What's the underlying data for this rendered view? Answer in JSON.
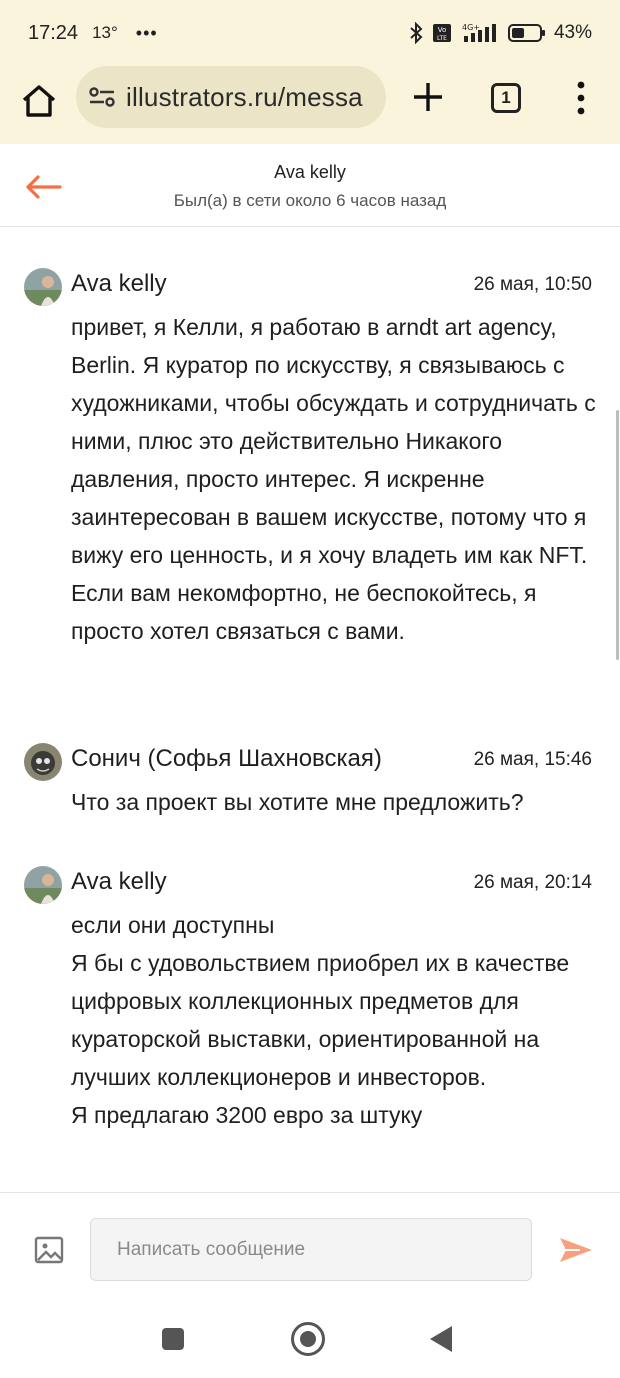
{
  "status_bar": {
    "time": "17:24",
    "temperature": "13°",
    "dots": "•••",
    "battery": "43%"
  },
  "browser": {
    "url": "illustrators.ru/messa",
    "tab_count": "1"
  },
  "chat": {
    "name": "Ava kelly",
    "status": "Был(а) в сети около 6 часов назад"
  },
  "messages": [
    {
      "author": "Ava kelly",
      "time": "26 мая, 10:50",
      "text": "привет, я Келли, я работаю в arndt art agency, Berlin. Я куратор по искусству, я связываюсь с художниками, чтобы обсуждать и сотрудничать с ними, плюс это действительно Никакого давления, просто интерес. Я искренне заинтересован в вашем искусстве, потому что я вижу его ценность, и я хочу владеть им как NFT. Если вам некомфортно, не беспокойтесь, я просто хотел связаться с вами."
    },
    {
      "author": "Сонич (Софья Шахновская)",
      "time": "26 мая, 15:46",
      "text": "Что за проект вы хотите мне предложить?"
    },
    {
      "author": "Ava kelly",
      "time": "26 мая, 20:14",
      "text": "если они доступны\nЯ бы с удовольствием приобрел их в качестве цифровых коллекционных предметов для кураторской выставки, ориентированной на лучших коллекционеров и инвесторов.\nЯ предлагаю 3200 евро за штуку"
    }
  ],
  "composer": {
    "placeholder": "Написать сообщение"
  },
  "colors": {
    "accent": "#f36f45",
    "browser_bg": "#fbf4dd",
    "url_pill": "#ece4c6"
  }
}
